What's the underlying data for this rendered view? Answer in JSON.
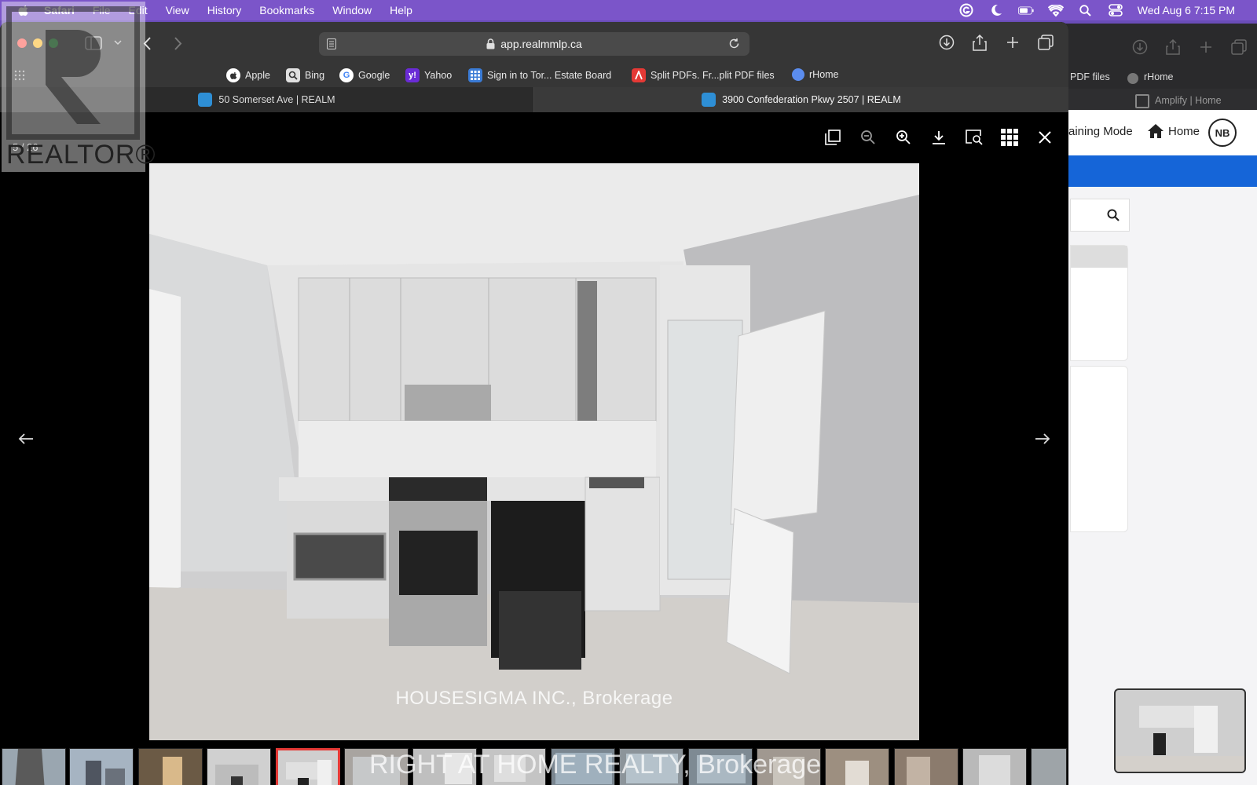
{
  "menubar": {
    "app": "Safari",
    "items": [
      "File",
      "Edit",
      "View",
      "History",
      "Bookmarks",
      "Window",
      "Help"
    ],
    "clock": "Wed Aug 6  7:15 PM"
  },
  "toolbar": {
    "url": "app.realmmlp.ca"
  },
  "bookmarks": [
    {
      "label": "Apple",
      "icon": "apple-icon",
      "color": "#ffffff"
    },
    {
      "label": "Bing",
      "icon": "search-icon",
      "color": "#e0e0e0"
    },
    {
      "label": "Google",
      "icon": "google-icon",
      "color": "#ffffff"
    },
    {
      "label": "Yahoo",
      "icon": "yahoo-icon",
      "color": "#6a2bd6"
    },
    {
      "label": "Sign in to Tor... Estate Board",
      "icon": "grid-icon",
      "color": "#3a7bd5"
    },
    {
      "label": "Split PDFs. Fr...plit PDF files",
      "icon": "pdf-icon",
      "color": "#e53935"
    },
    {
      "label": "rHome",
      "icon": "rhome-icon",
      "color": "#5b8def"
    }
  ],
  "tabs": [
    {
      "label": "50 Somerset Ave | REALM"
    },
    {
      "label": "3900 Confederation Pkwy 2507 | REALM"
    }
  ],
  "background_window": {
    "bookmark_1": "PDF files",
    "bookmark_2": "rHome",
    "tab": "Amplify | Home",
    "nav_mode": "aining Mode",
    "nav_home": "Home",
    "avatar": "NB"
  },
  "viewer": {
    "counter": "5 / 26",
    "watermark": "HOUSESIGMA INC., Brokerage",
    "thumb_watermark": "RIGHT AT HOME REALTY, Brokerage",
    "logo_text": "REALTOR",
    "thumbnail_count": 16,
    "active_thumbnail": 5
  }
}
